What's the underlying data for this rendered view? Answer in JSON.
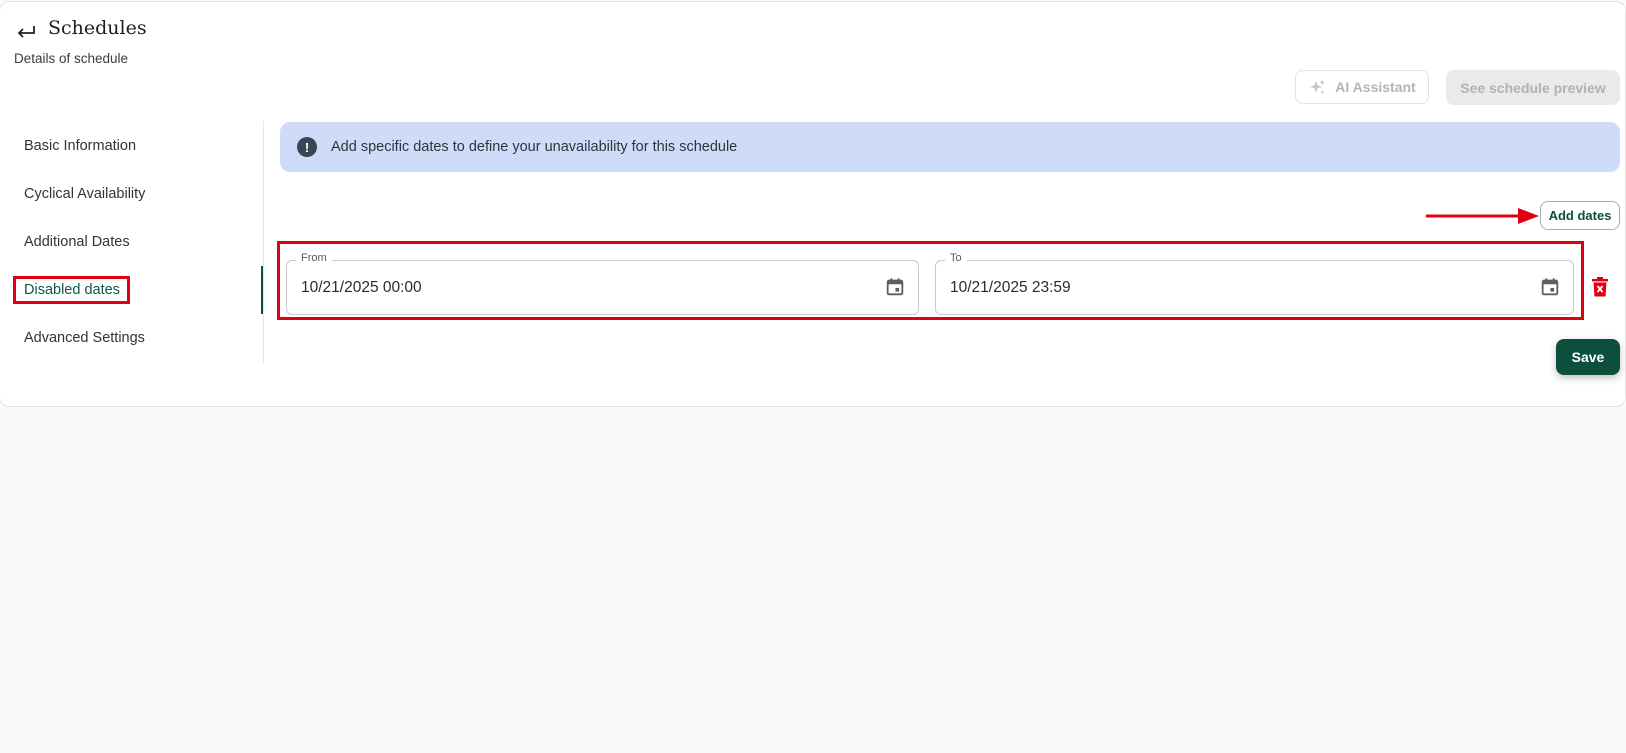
{
  "header": {
    "title": "Schedules",
    "subtitle": "Details of schedule"
  },
  "toolbar": {
    "ai_assistant_label": "AI Assistant",
    "preview_label": "See schedule preview"
  },
  "sidebar": {
    "items": [
      {
        "label": "Basic Information"
      },
      {
        "label": "Cyclical Availability"
      },
      {
        "label": "Additional Dates"
      },
      {
        "label": "Disabled dates",
        "active": true
      },
      {
        "label": "Advanced Settings"
      }
    ]
  },
  "banner": {
    "icon": "exclamation-icon",
    "text": "Add specific dates to define your unavailability for this schedule"
  },
  "disabled_dates": {
    "add_label": "Add dates",
    "rows": [
      {
        "from_label": "From",
        "from_value": "10/21/2025 00:00",
        "to_label": "To",
        "to_value": "10/21/2025 23:59"
      }
    ]
  },
  "save_label": "Save",
  "colors": {
    "brand": "#0b4f3c",
    "banner": "#cfdcf8",
    "annotation": "#e0000f",
    "delete": "#e0000f"
  }
}
